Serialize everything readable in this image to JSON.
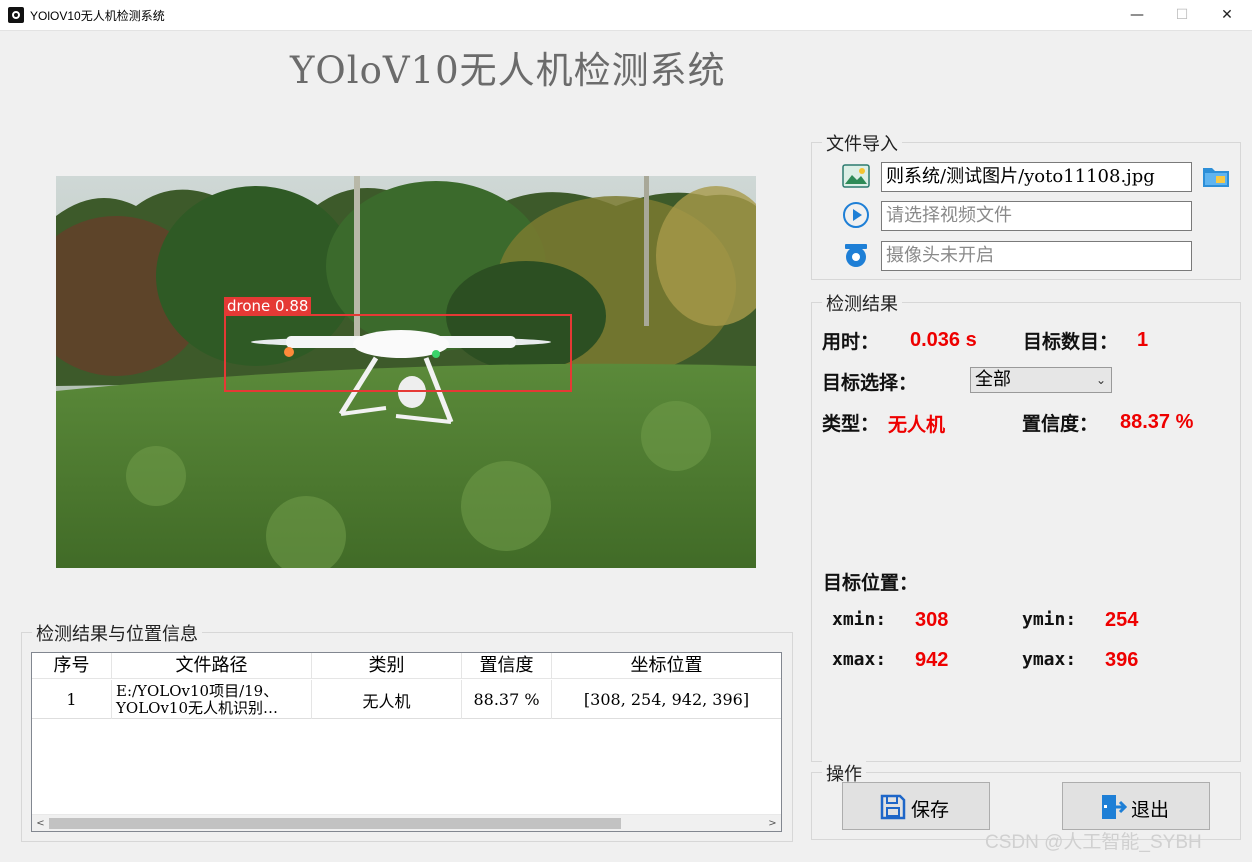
{
  "window": {
    "title": "YOlOV10无人机检测系统",
    "minimize": "—",
    "maximize": "☐",
    "close": "✕"
  },
  "app_title": "YOloV10无人机检测系统",
  "detection_overlay": {
    "label": "drone 0.88"
  },
  "file_import": {
    "title": "文件导入",
    "image_path": "则系统/测试图片/yoto11108.jpg",
    "video_placeholder": "请选择视频文件",
    "camera_placeholder": "摄像头未开启"
  },
  "results": {
    "title": "检测结果",
    "time_label": "用时：",
    "time_value": "0.036 s",
    "count_label": "目标数目：",
    "count_value": "1",
    "select_label": "目标选择：",
    "select_value": "全部",
    "type_label": "类型：",
    "type_value": "无人机",
    "confidence_label": "置信度：",
    "confidence_value": "88.37 %",
    "position_label": "目标位置：",
    "xmin_label": "xmin:",
    "xmin_value": "308",
    "ymin_label": "ymin:",
    "ymin_value": "254",
    "xmax_label": "xmax:",
    "xmax_value": "942",
    "ymax_label": "ymax:",
    "ymax_value": "396"
  },
  "operations": {
    "title": "操作",
    "save_label": "保存",
    "exit_label": "退出"
  },
  "table": {
    "title": "检测结果与位置信息",
    "headers": [
      "序号",
      "文件路径",
      "类别",
      "置信度",
      "坐标位置"
    ],
    "rows": [
      {
        "index": "1",
        "path_line1": "E:/YOLOv10项目/19、",
        "path_line2": "YOLOv10无人机识别…",
        "category": "无人机",
        "confidence": "88.37 %",
        "coords": "[308, 254, 942, 396]"
      }
    ],
    "scroll_left": "<",
    "scroll_right": ">"
  },
  "watermark": "CSDN @人工智能_SYBH",
  "colors": {
    "accent_red": "#ee0000",
    "box_red": "#e53935",
    "title_gray": "#6b6b6b"
  }
}
